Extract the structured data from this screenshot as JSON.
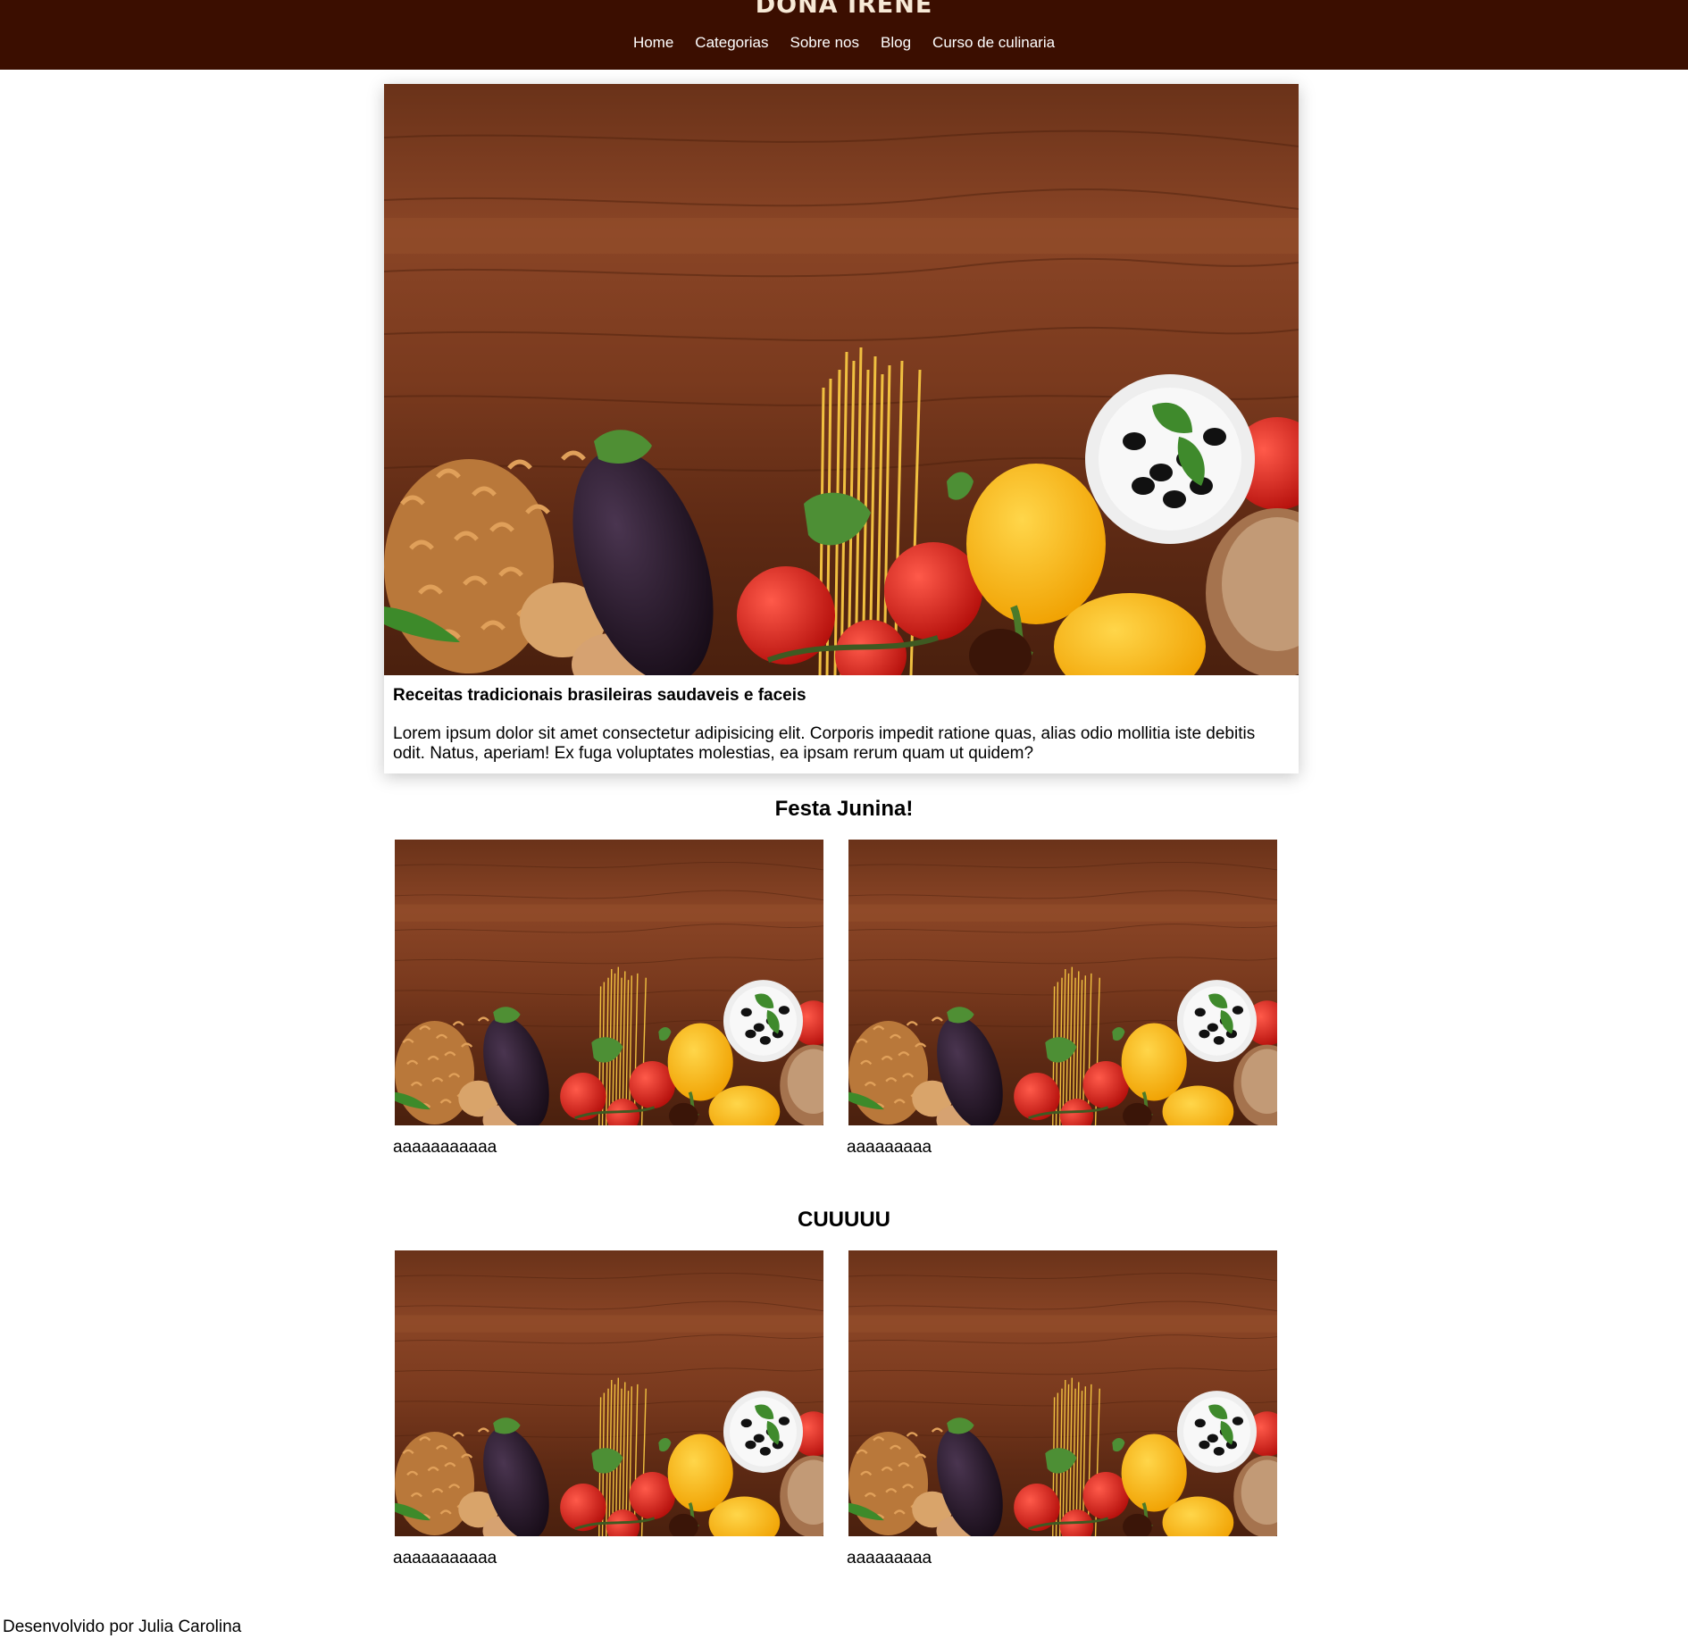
{
  "header": {
    "logo": "DONA IRENE",
    "nav": [
      "Home",
      "Categorias",
      "Sobre nos",
      "Blog",
      "Curso de culinaria"
    ],
    "background": "#3b0e00"
  },
  "featured": {
    "image_icon": "food-photo",
    "title": "Receitas tradicionais brasileiras saudaveis e faceis",
    "description": "Lorem ipsum dolor sit amet consectetur adipisicing elit. Corporis impedit ratione quas, alias odio mollitia iste debitis odit. Natus, aperiam! Ex fuga voluptates molestias, ea ipsam rerum quam ut quidem?"
  },
  "sections": [
    {
      "title": "Festa Junina!",
      "cards": [
        {
          "caption": "aaaaaaaaaaa"
        },
        {
          "caption": "aaaaaaaaa"
        }
      ]
    },
    {
      "title": "CUUUUU",
      "cards": [
        {
          "caption": "aaaaaaaaaaa"
        },
        {
          "caption": "aaaaaaaaa"
        }
      ]
    }
  ],
  "footer": {
    "text": "Desenvolvido por Julia Carolina"
  }
}
